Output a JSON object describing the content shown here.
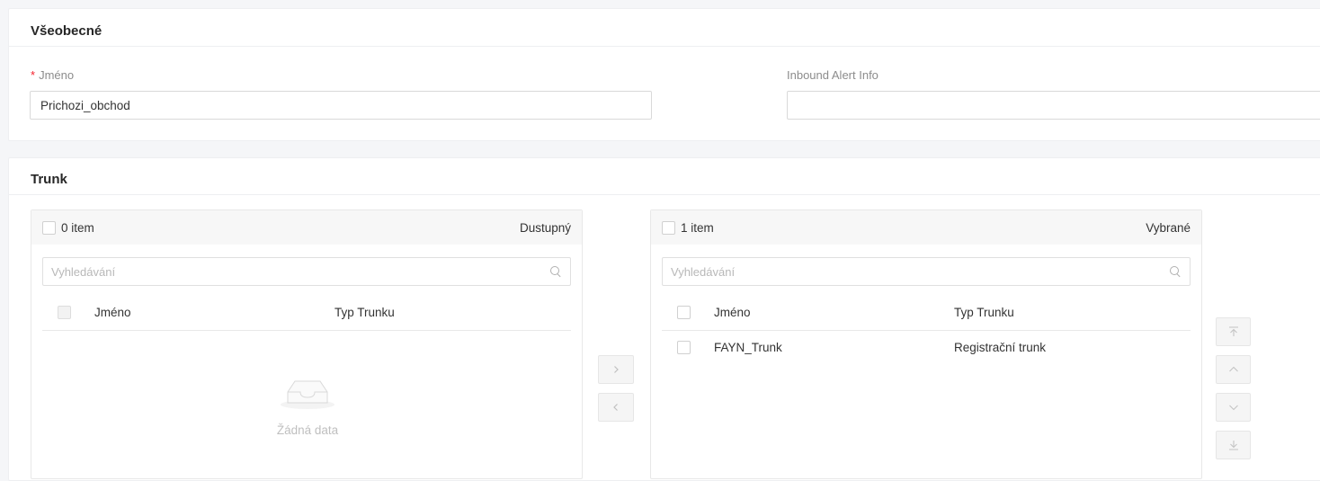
{
  "general": {
    "title": "Všeobecné",
    "name_label": "Jméno",
    "name_value": "Prichozi_obchod",
    "alert_label": "Inbound Alert Info",
    "alert_value": ""
  },
  "trunk": {
    "title": "Trunk",
    "available": {
      "count": "0 item",
      "title": "Dustupný",
      "search_placeholder": "Vyhledávání",
      "columns": [
        "Jméno",
        "Typ Trunku"
      ],
      "rows": [],
      "empty_text": "Žádná data"
    },
    "selected": {
      "count": "1 item",
      "title": "Vybrané",
      "search_placeholder": "Vyhledávání",
      "columns": [
        "Jméno",
        "Typ Trunku"
      ],
      "rows": [
        {
          "name": "FAYN_Trunk",
          "type": "Registrační trunk"
        }
      ]
    },
    "move_right_icon": "chevron-right-icon",
    "move_left_icon": "chevron-left-icon",
    "sort_icons": [
      "move-top-icon",
      "move-up-icon",
      "move-down-icon",
      "move-bottom-icon"
    ]
  },
  "colors": {
    "required": "#f5222d",
    "label": "#8c8c8c",
    "border": "#d9d9d9",
    "disabled_button": "#f5f5f5"
  }
}
